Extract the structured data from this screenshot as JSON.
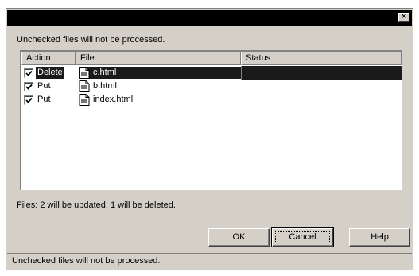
{
  "dialog": {
    "close_glyph": "×",
    "top_message": "Unchecked files will not be processed."
  },
  "list": {
    "columns": [
      "Action",
      "File",
      "Status"
    ],
    "rows": [
      {
        "checked": true,
        "action": "Delete",
        "file": "c.html",
        "status": "",
        "selected": true
      },
      {
        "checked": true,
        "action": "Put",
        "file": "b.html",
        "status": "",
        "selected": false
      },
      {
        "checked": true,
        "action": "Put",
        "file": "index.html",
        "status": "",
        "selected": false
      }
    ]
  },
  "summary": "Files: 2 will be updated. 1 will be deleted.",
  "buttons": {
    "ok": "OK",
    "cancel": "Cancel",
    "help": "Help"
  },
  "status_bar": "Unchecked files will not be processed.",
  "icons": {
    "checkbox": "checkmark-icon",
    "file": "html-file-icon",
    "close": "close-icon"
  }
}
